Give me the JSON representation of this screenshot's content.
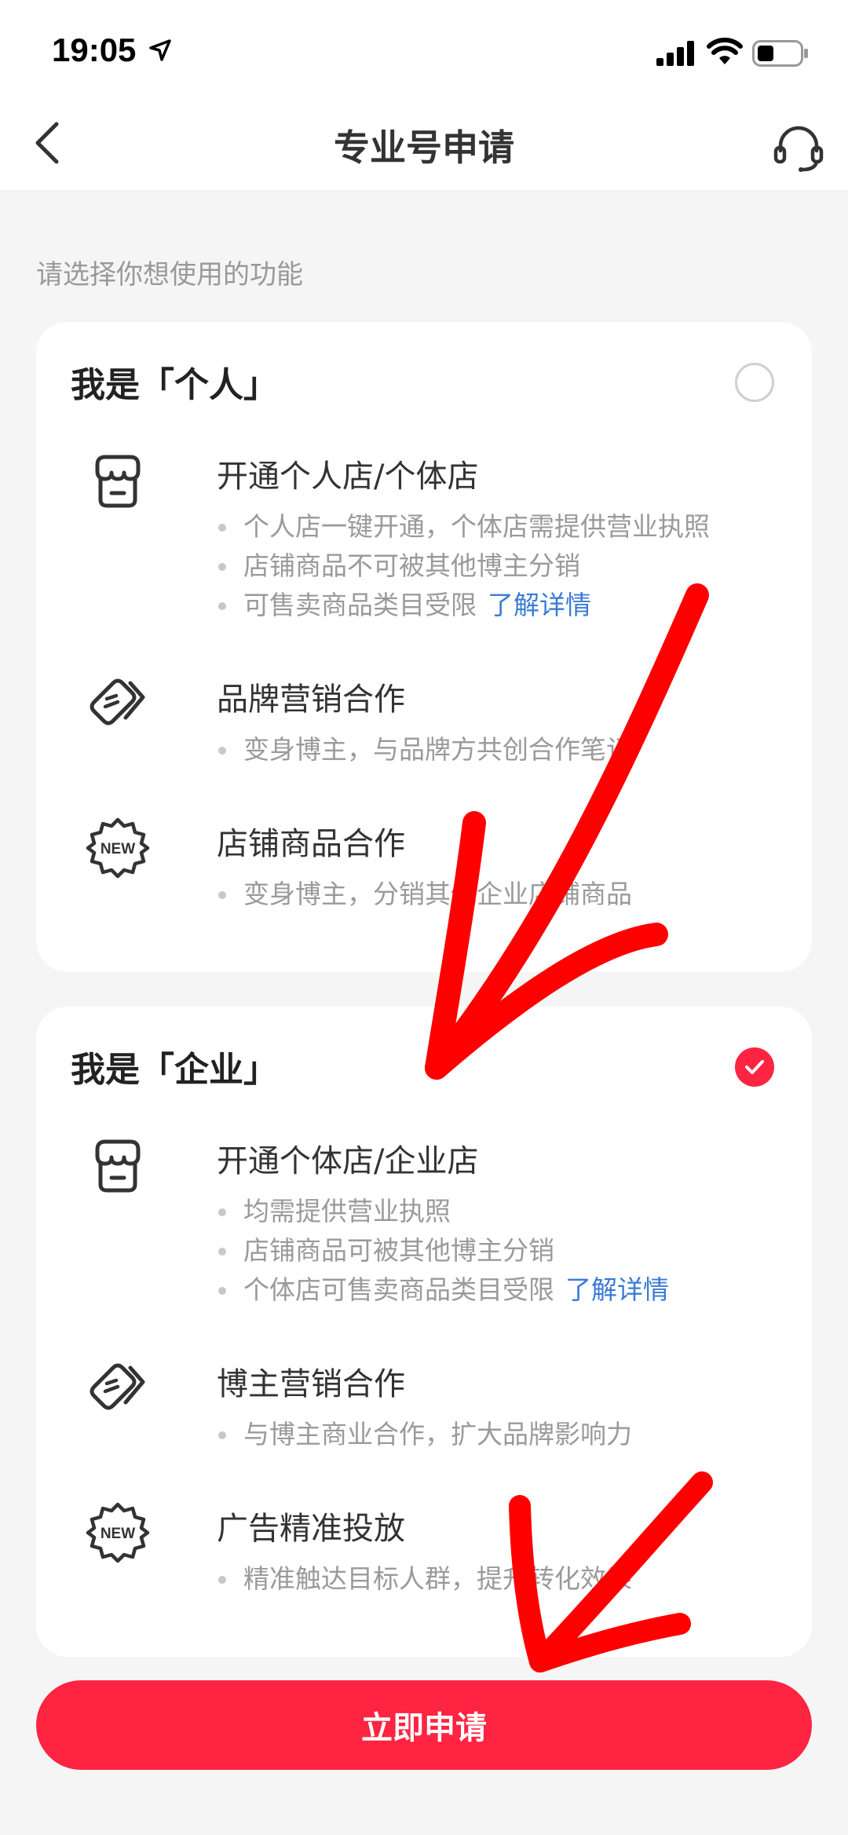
{
  "status_bar": {
    "time": "19:05"
  },
  "nav": {
    "title": "专业号申请"
  },
  "section_hint": "请选择你想使用的功能",
  "cards": [
    {
      "title": "我是「个人」",
      "selected": false,
      "features": [
        {
          "icon": "shop-icon",
          "name": "开通个人店/个体店",
          "bullets": [
            "个人店一键开通，个体店需提供营业执照",
            "店铺商品不可被其他博主分销",
            "可售卖商品类目受限"
          ],
          "link": "了解详情"
        },
        {
          "icon": "tag-icon",
          "name": "品牌营销合作",
          "bullets": [
            "变身博主，与品牌方共创合作笔记"
          ]
        },
        {
          "icon": "new-badge-icon",
          "name": "店铺商品合作",
          "bullets": [
            "变身博主，分销其他企业店铺商品"
          ]
        }
      ]
    },
    {
      "title": "我是「企业」",
      "selected": true,
      "features": [
        {
          "icon": "shop-icon",
          "name": "开通个体店/企业店",
          "bullets": [
            "均需提供营业执照",
            "店铺商品可被其他博主分销",
            "个体店可售卖商品类目受限"
          ],
          "link": "了解详情"
        },
        {
          "icon": "tag-icon",
          "name": "博主营销合作",
          "bullets": [
            "与博主商业合作，扩大品牌影响力"
          ]
        },
        {
          "icon": "new-badge-icon",
          "name": "广告精准投放",
          "bullets": [
            "精准触达目标人群，提升转化效果"
          ]
        }
      ]
    }
  ],
  "apply_button": "立即申请",
  "colors": {
    "accent": "#ff2442",
    "link": "#3a7bd5",
    "annotation": "#ff0000"
  }
}
